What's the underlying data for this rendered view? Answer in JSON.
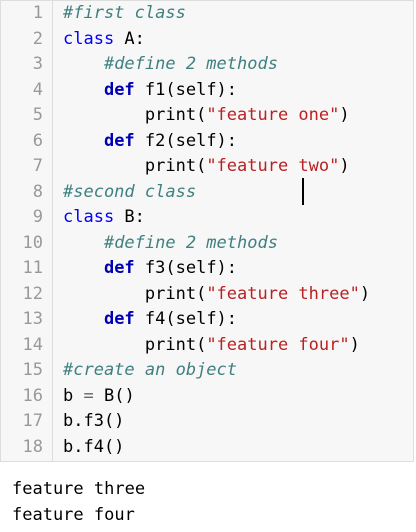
{
  "editor": {
    "lines": [
      {
        "num": "1",
        "indent": "",
        "parts": [
          {
            "t": "#first class",
            "c": "cm"
          }
        ]
      },
      {
        "num": "2",
        "indent": "",
        "parts": [
          {
            "t": "class",
            "c": "kw"
          },
          {
            "t": " A:",
            "c": ""
          }
        ]
      },
      {
        "num": "3",
        "indent": "    ",
        "parts": [
          {
            "t": "#define 2 methods",
            "c": "cm"
          }
        ]
      },
      {
        "num": "4",
        "indent": "    ",
        "parts": [
          {
            "t": "def",
            "c": "kw-b"
          },
          {
            "t": " f1(self):",
            "c": ""
          }
        ]
      },
      {
        "num": "5",
        "indent": "        ",
        "parts": [
          {
            "t": "print(",
            "c": ""
          },
          {
            "t": "\"feature one\"",
            "c": "st"
          },
          {
            "t": ")",
            "c": ""
          }
        ]
      },
      {
        "num": "6",
        "indent": "    ",
        "parts": [
          {
            "t": "def",
            "c": "kw-b"
          },
          {
            "t": " f2(self):",
            "c": ""
          }
        ]
      },
      {
        "num": "7",
        "indent": "        ",
        "parts": [
          {
            "t": "print(",
            "c": ""
          },
          {
            "t": "\"feature two\"",
            "c": "st"
          },
          {
            "t": ")",
            "c": ""
          }
        ]
      },
      {
        "num": "8",
        "indent": "",
        "parts": [
          {
            "t": "#second class",
            "c": "cm"
          }
        ]
      },
      {
        "num": "9",
        "indent": "",
        "parts": [
          {
            "t": "class",
            "c": "kw"
          },
          {
            "t": " B:",
            "c": ""
          }
        ]
      },
      {
        "num": "10",
        "indent": "    ",
        "parts": [
          {
            "t": "#define 2 methods",
            "c": "cm"
          }
        ]
      },
      {
        "num": "11",
        "indent": "    ",
        "parts": [
          {
            "t": "def",
            "c": "kw-b"
          },
          {
            "t": " f3(self):",
            "c": ""
          }
        ]
      },
      {
        "num": "12",
        "indent": "        ",
        "parts": [
          {
            "t": "print(",
            "c": ""
          },
          {
            "t": "\"feature three\"",
            "c": "st"
          },
          {
            "t": ")",
            "c": ""
          }
        ]
      },
      {
        "num": "13",
        "indent": "    ",
        "parts": [
          {
            "t": "def",
            "c": "kw-b"
          },
          {
            "t": " f4(self):",
            "c": ""
          }
        ]
      },
      {
        "num": "14",
        "indent": "        ",
        "parts": [
          {
            "t": "print(",
            "c": ""
          },
          {
            "t": "\"feature four\"",
            "c": "st"
          },
          {
            "t": ")",
            "c": ""
          }
        ]
      },
      {
        "num": "15",
        "indent": "",
        "parts": [
          {
            "t": "#create an object",
            "c": "cm"
          }
        ]
      },
      {
        "num": "16",
        "indent": "",
        "parts": [
          {
            "t": "b ",
            "c": ""
          },
          {
            "t": "=",
            "c": "op"
          },
          {
            "t": " B()",
            "c": ""
          }
        ]
      },
      {
        "num": "17",
        "indent": "",
        "parts": [
          {
            "t": "b.f3()",
            "c": ""
          }
        ]
      },
      {
        "num": "18",
        "indent": "",
        "parts": [
          {
            "t": "b.f4()",
            "c": ""
          }
        ]
      }
    ]
  },
  "output": {
    "lines": [
      "feature three",
      "feature four"
    ]
  },
  "colors": {
    "keyword": "#0000ff",
    "comment": "#408080",
    "string": "#ba2121",
    "line_number": "#999999",
    "editor_background": "#f7f7f7"
  }
}
